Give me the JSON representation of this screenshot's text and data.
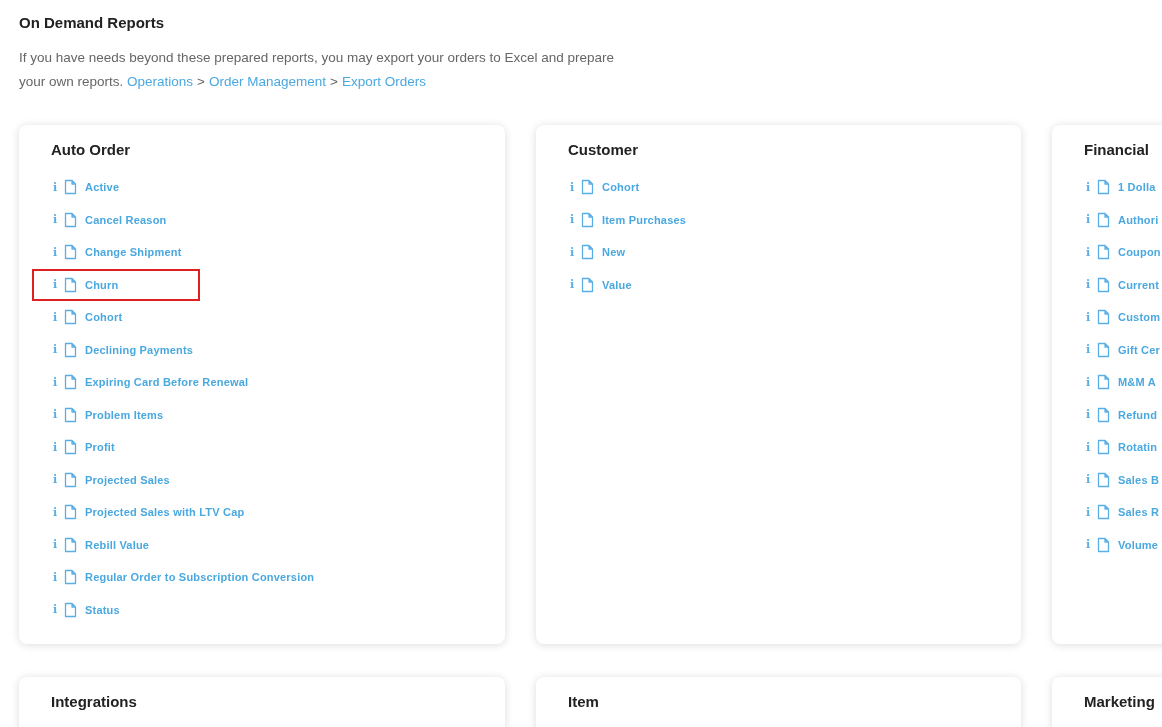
{
  "page": {
    "title": "On Demand Reports",
    "intro": "If you have needs beyond these prepared reports, you may export your orders to Excel and prepare your own reports.",
    "breadcrumb": [
      "Operations",
      "Order Management",
      "Export Orders"
    ],
    "separator": ">"
  },
  "sections": [
    {
      "title": "Auto Order",
      "items": [
        {
          "info": "i",
          "label": "Active",
          "highlighted": false
        },
        {
          "info": "i",
          "label": "Cancel Reason",
          "highlighted": false
        },
        {
          "info": "i",
          "label": "Change Shipment",
          "highlighted": false
        },
        {
          "info": "i",
          "label": "Churn",
          "highlighted": true
        },
        {
          "info": "i",
          "label": "Cohort",
          "highlighted": false
        },
        {
          "info": "i",
          "label": "Declining Payments",
          "highlighted": false
        },
        {
          "info": "i",
          "label": "Expiring Card Before Renewal",
          "highlighted": false
        },
        {
          "info": "i",
          "label": "Problem Items",
          "highlighted": false
        },
        {
          "info": "i",
          "label": "Profit",
          "highlighted": false
        },
        {
          "info": "i",
          "label": "Projected Sales",
          "highlighted": false
        },
        {
          "info": "i",
          "label": "Projected Sales with LTV Cap",
          "highlighted": false
        },
        {
          "info": "i",
          "label": "Rebill Value",
          "highlighted": false
        },
        {
          "info": "i",
          "label": "Regular Order to Subscription Conversion",
          "highlighted": false
        },
        {
          "info": "i",
          "label": "Status",
          "highlighted": false
        }
      ]
    },
    {
      "title": "Customer",
      "items": [
        {
          "info": "i",
          "label": "Cohort",
          "highlighted": false
        },
        {
          "info": "i",
          "label": "Item Purchases",
          "highlighted": false
        },
        {
          "info": "i",
          "label": "New",
          "highlighted": false
        },
        {
          "info": "i",
          "label": "Value",
          "highlighted": false
        }
      ]
    },
    {
      "title": "Financial",
      "items": [
        {
          "info": "i",
          "label": "1 Dolla",
          "highlighted": false
        },
        {
          "info": "i",
          "label": "Authori",
          "highlighted": false
        },
        {
          "info": "i",
          "label": "Coupon",
          "highlighted": false
        },
        {
          "info": "i",
          "label": "Current",
          "highlighted": false
        },
        {
          "info": "i",
          "label": "Custom",
          "highlighted": false
        },
        {
          "info": "i",
          "label": "Gift Cer",
          "highlighted": false
        },
        {
          "info": "i",
          "label": "M&M A",
          "highlighted": false
        },
        {
          "info": "i",
          "label": "Refund",
          "highlighted": false
        },
        {
          "info": "i",
          "label": "Rotatin",
          "highlighted": false
        },
        {
          "info": "i",
          "label": "Sales B",
          "highlighted": false
        },
        {
          "info": "i",
          "label": "Sales R",
          "highlighted": false
        },
        {
          "info": "i",
          "label": "Volume",
          "highlighted": false
        }
      ]
    },
    {
      "title": "Integrations"
    },
    {
      "title": "Item"
    },
    {
      "title": "Marketing"
    }
  ]
}
